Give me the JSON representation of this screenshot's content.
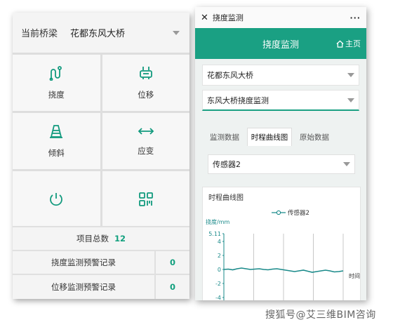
{
  "left": {
    "header_label": "当前桥梁",
    "bridge_select": "花都东风大桥",
    "tiles": [
      {
        "label": "挠度",
        "icon": "deflection-icon"
      },
      {
        "label": "位移",
        "icon": "displacement-icon"
      },
      {
        "label": "倾斜",
        "icon": "tilt-icon"
      },
      {
        "label": "应变",
        "icon": "strain-icon"
      },
      {
        "label": "",
        "icon": "power-icon"
      },
      {
        "label": "",
        "icon": "qrcode-icon"
      }
    ],
    "project_total_label": "项目总数",
    "project_total_value": "12",
    "records": [
      {
        "label": "挠度监测预警记录",
        "value": "0"
      },
      {
        "label": "位移监测预警记录",
        "value": "0"
      }
    ]
  },
  "right": {
    "window_title": "挠度监测",
    "more": "···",
    "close": "✕",
    "page_title": "挠度监测",
    "home_label": "主页",
    "bridge_select": "花都东风大桥",
    "monitor_select": "东风大桥挠度监测",
    "tabs": [
      "监测数据",
      "时程曲线图",
      "原始数据"
    ],
    "active_tab": 1,
    "sensor_select": "传感器2",
    "chart_card_title": "时程曲线图"
  },
  "chart_data": {
    "type": "line",
    "title": "",
    "ylabel": "挠度/mm",
    "xlabel": "时间",
    "ylim": [
      -5.11,
      5.11
    ],
    "yticks": [
      "5.11",
      "4",
      "2",
      "0",
      "-2",
      "-4"
    ],
    "series": [
      {
        "name": "传感器2",
        "color": "#1a8a8a",
        "values": [
          0.0,
          0.05,
          -0.05,
          0.1,
          0.2,
          0.1,
          0.0,
          0.05,
          0.1,
          0.0,
          -0.05,
          0.05,
          0.1,
          0.0,
          -0.1,
          -0.2,
          -0.3,
          -0.2,
          -0.1,
          -0.25,
          -0.4,
          -0.3,
          -0.2,
          -0.1,
          -0.2,
          -0.35,
          -0.3,
          -0.2
        ]
      }
    ]
  },
  "watermark": "搜狐号@艾三维BIM咨询"
}
